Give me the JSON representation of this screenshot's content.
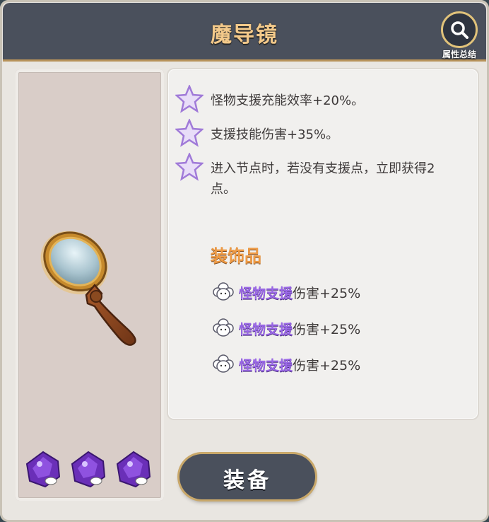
{
  "header": {
    "title": "魔导镜",
    "summary_label": "属性总结",
    "summary_icon": "search-icon"
  },
  "item": {
    "image": "magnifying-glass",
    "gems": [
      "purple-gem",
      "purple-gem",
      "purple-gem"
    ]
  },
  "attributes": [
    {
      "icon": "star-icon",
      "text": "怪物支援充能效率+20%。"
    },
    {
      "icon": "star-icon",
      "text": "支援技能伤害+35%。"
    },
    {
      "icon": "star-icon",
      "text": "进入节点时，若没有支援点，立即获得2点。"
    }
  ],
  "decorations": {
    "title": "装饰品",
    "items": [
      {
        "icon": "sheep-icon",
        "highlight": "怪物支援",
        "rest": "伤害+25%"
      },
      {
        "icon": "sheep-icon",
        "highlight": "怪物支援",
        "rest": "伤害+25%"
      },
      {
        "icon": "sheep-icon",
        "highlight": "怪物支援",
        "rest": "伤害+25%"
      }
    ]
  },
  "actions": {
    "equip_label": "装备"
  },
  "colors": {
    "header_bg": "#4a505c",
    "title": "#f3c98a",
    "gold_border": "#b8935a",
    "deco_title": "#ee9a44",
    "deco_highlight": "#9a68e6"
  }
}
